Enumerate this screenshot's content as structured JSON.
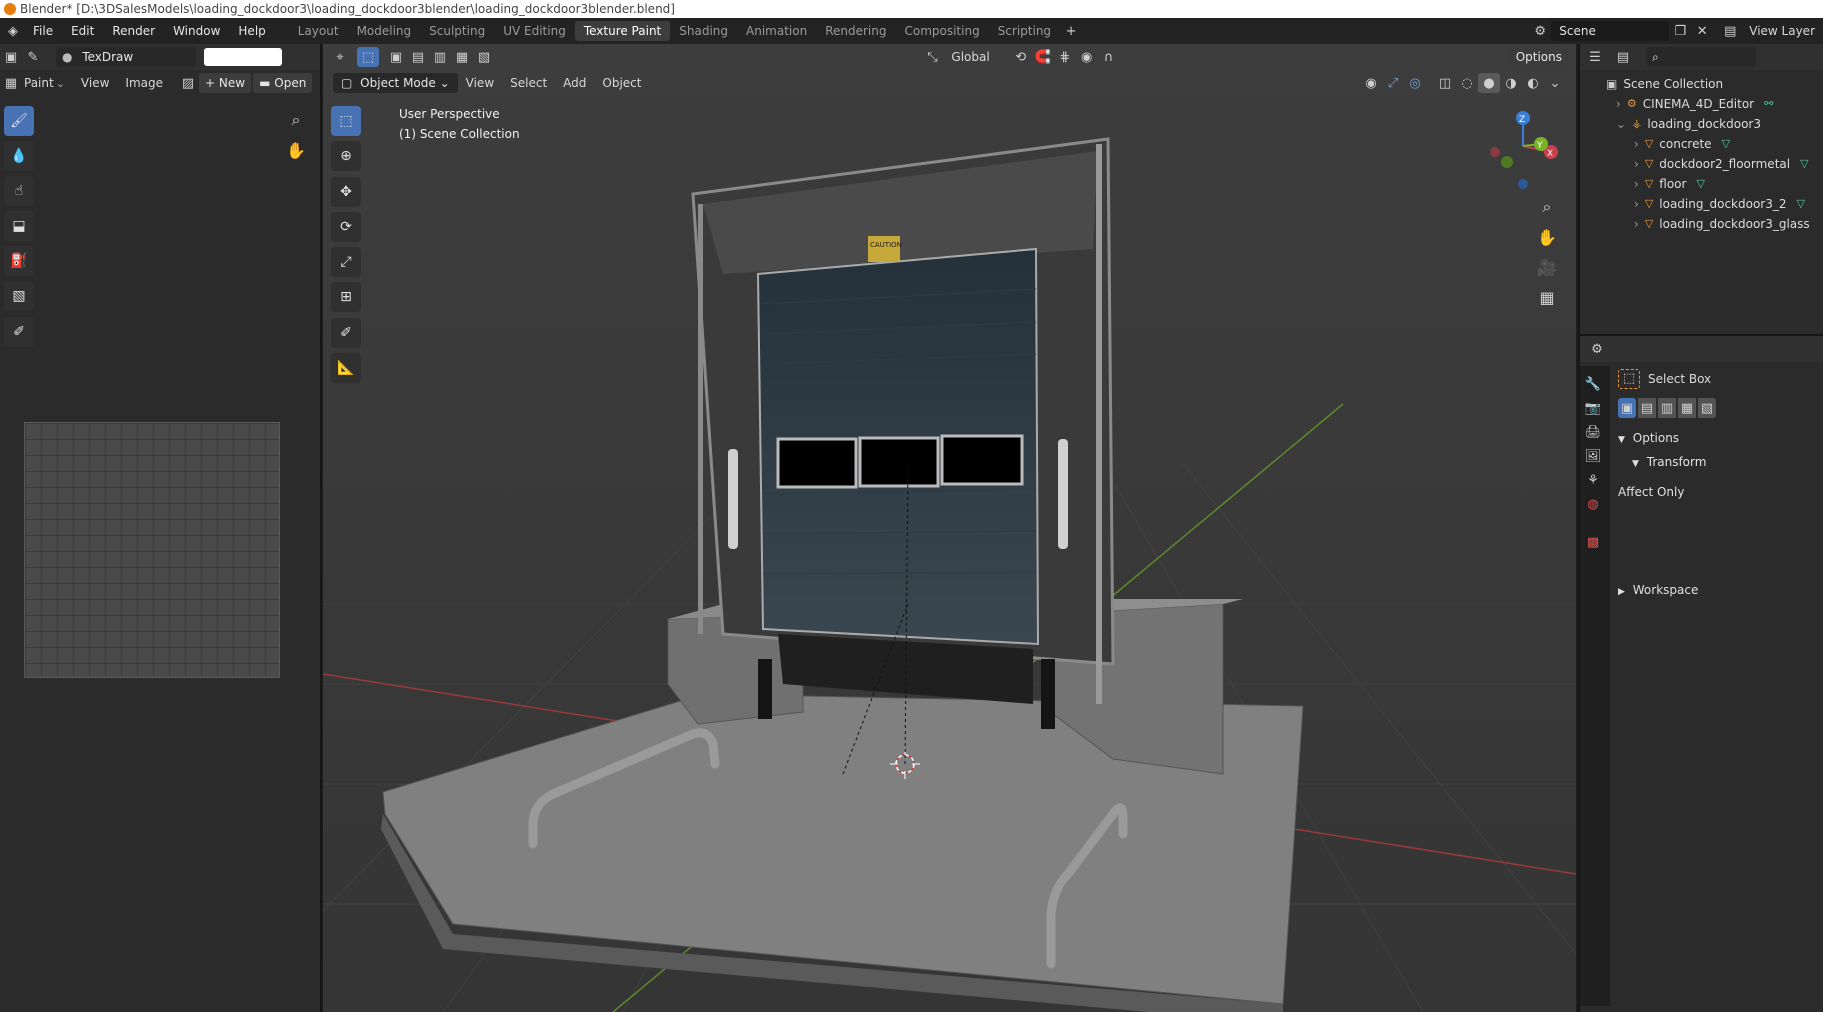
{
  "window": {
    "title": "Blender* [D:\\3DSalesModels\\loading_dockdoor3\\loading_dockdoor3blender\\loading_dockdoor3blender.blend]"
  },
  "menu": [
    "File",
    "Edit",
    "Render",
    "Window",
    "Help"
  ],
  "workspaces": [
    {
      "label": "Layout"
    },
    {
      "label": "Modeling"
    },
    {
      "label": "Sculpting"
    },
    {
      "label": "UV Editing"
    },
    {
      "label": "Texture Paint"
    },
    {
      "label": "Shading"
    },
    {
      "label": "Animation"
    },
    {
      "label": "Rendering"
    },
    {
      "label": "Compositing"
    },
    {
      "label": "Scripting"
    }
  ],
  "scene": {
    "name": "Scene",
    "view_layer": "View Layer"
  },
  "image_editor": {
    "brush_name": "TexDraw",
    "mode": "Paint",
    "view": "View",
    "image": "Image",
    "new": "New",
    "open": "Open"
  },
  "viewport": {
    "mode": "Object Mode",
    "menu": [
      "View",
      "Select",
      "Add",
      "Object"
    ],
    "orientation": "Global",
    "options": "Options",
    "overlay_line1": "User Perspective",
    "overlay_line2": "(1) Scene Collection",
    "decal_text": "CAUTION",
    "gizmo": {
      "x": "X",
      "y": "Y",
      "z": "Z"
    }
  },
  "outliner": {
    "root": "Scene Collection",
    "items": [
      {
        "label": "CINEMA_4D_Editor",
        "depth": 1
      },
      {
        "label": "loading_dockdoor3",
        "depth": 1
      },
      {
        "label": "concrete",
        "depth": 2
      },
      {
        "label": "dockdoor2_floormetal",
        "depth": 2
      },
      {
        "label": "floor",
        "depth": 2
      },
      {
        "label": "loading_dockdoor3_2",
        "depth": 2
      },
      {
        "label": "loading_dockdoor3_glass",
        "depth": 2
      }
    ]
  },
  "properties": {
    "tool_name": "Select Box",
    "options": "Options",
    "transform": "Transform",
    "affect_only": "Affect Only",
    "workspace": "Workspace"
  },
  "colors": {
    "accent": "#4772b3",
    "x_axis": "#c8404a",
    "y_axis": "#7ab32a",
    "z_axis": "#3b7ed6"
  }
}
